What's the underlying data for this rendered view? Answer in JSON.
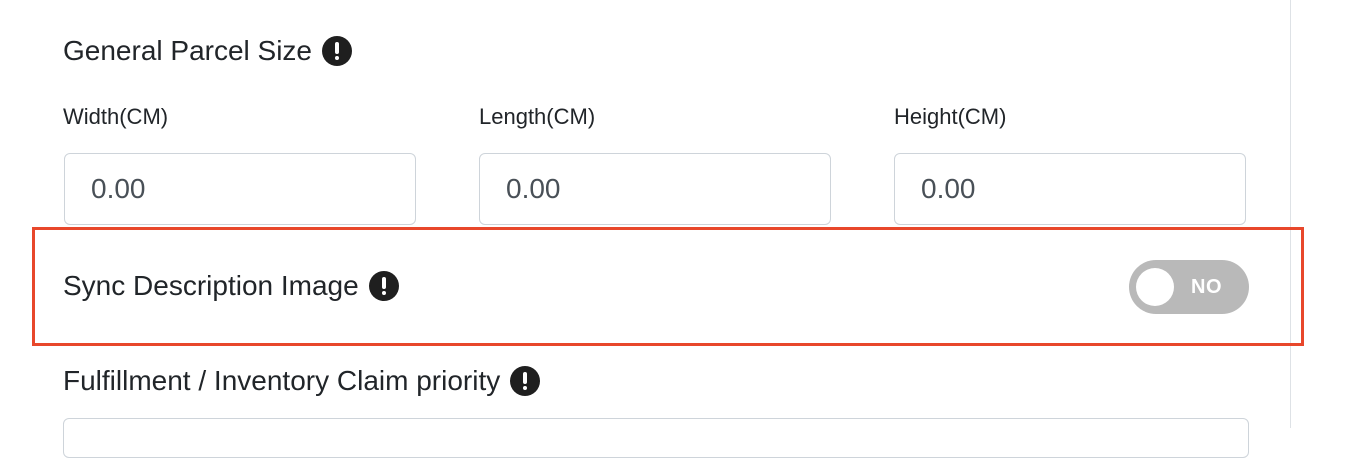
{
  "parcel_size": {
    "title": "General Parcel Size",
    "fields": [
      {
        "label": "Width(CM)",
        "value": "0.00"
      },
      {
        "label": "Length(CM)",
        "value": "0.00"
      },
      {
        "label": "Height(CM)",
        "value": "0.00"
      }
    ]
  },
  "sync_description_image": {
    "label": "Sync Description Image",
    "toggle_text": "NO",
    "enabled": false,
    "highlight_color": "#e8472b"
  },
  "fulfillment": {
    "label": "Fulfillment / Inventory Claim priority"
  },
  "icons": {
    "info": "exclamation-circle-icon"
  }
}
